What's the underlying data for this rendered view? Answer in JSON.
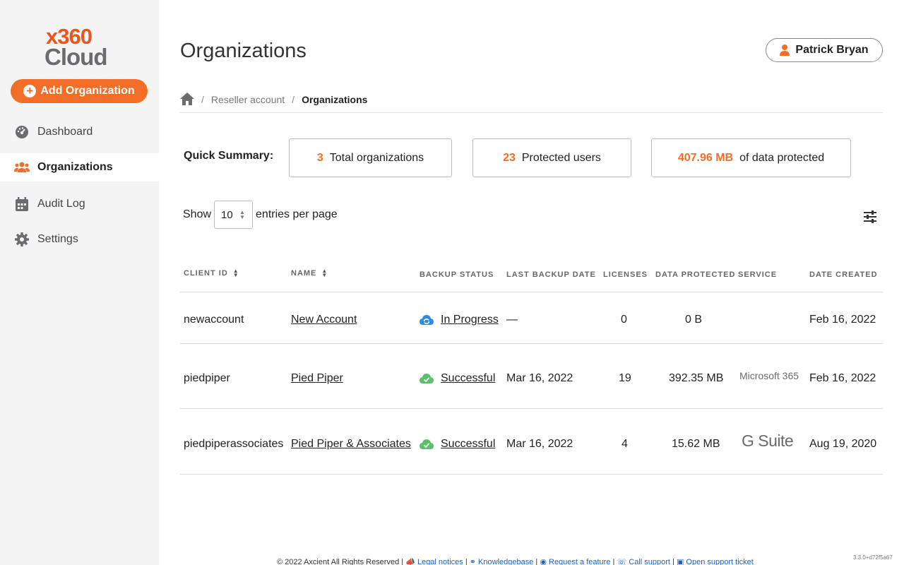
{
  "app": {
    "logo_top": "x360",
    "logo_bottom": "Cloud",
    "brand_color": "#f26e26"
  },
  "sidebar": {
    "add_button": {
      "label": "Add Organization",
      "icon": "plus-circle-icon"
    },
    "items": [
      {
        "label": "Dashboard",
        "icon": "dashboard-gauge-icon",
        "active": false
      },
      {
        "label": "Organizations",
        "icon": "users-group-icon",
        "active": true
      },
      {
        "label": "Audit Log",
        "icon": "calendar-icon",
        "active": false
      },
      {
        "label": "Settings",
        "icon": "gear-icon",
        "active": false
      }
    ]
  },
  "header": {
    "title": "Organizations",
    "user": {
      "name": "Patrick Bryan",
      "icon": "user-icon"
    }
  },
  "breadcrumb": {
    "home_icon": "home-icon",
    "items": [
      "Reseller account",
      "Organizations"
    ]
  },
  "summary": {
    "label": "Quick Summary:",
    "cards": [
      {
        "value": "3",
        "label": "Total organizations"
      },
      {
        "value": "23",
        "label": "Protected users"
      },
      {
        "value": "407.96 MB",
        "label": "of data protected"
      }
    ]
  },
  "paging": {
    "show_label": "Show",
    "per_page": "10",
    "suffix": "entries per page",
    "filter_icon": "sliders-icon"
  },
  "table": {
    "columns": [
      "CLIENT ID",
      "NAME",
      "BACKUP STATUS",
      "LAST BACKUP DATE",
      "LICENSES",
      "DATA PROTECTED",
      "SERVICE",
      "DATE CREATED"
    ],
    "rows": [
      {
        "client_id": "newaccount",
        "name": "New Account",
        "status": "In Progress",
        "status_icon": "sync-cloud-icon",
        "last_backup": "—",
        "licenses": "0",
        "data": "0 B",
        "service": "",
        "created": "Feb 16, 2022"
      },
      {
        "client_id": "piedpiper",
        "name": "Pied Piper",
        "status": "Successful",
        "status_icon": "cloud-check-icon",
        "last_backup": "Mar 16, 2022",
        "licenses": "19",
        "data": "392.35 MB",
        "service": "Microsoft 365",
        "created": "Feb 16, 2022"
      },
      {
        "client_id": "piedpiperassociates",
        "name": "Pied Piper & Associates",
        "status": "Successful",
        "status_icon": "cloud-check-icon",
        "last_backup": "Mar 16, 2022",
        "licenses": "4",
        "data": "15.62 MB",
        "service": "G Suite",
        "created": "Aug 19, 2020"
      }
    ]
  },
  "footer": {
    "copyright": "© 2022 Axcient All Rights Reserved |",
    "links": [
      "Legal notices",
      "Knowledgebase",
      "Request a feature",
      "Call support",
      "Open support ticket"
    ],
    "version": "3.3.0+d72f5a67"
  }
}
